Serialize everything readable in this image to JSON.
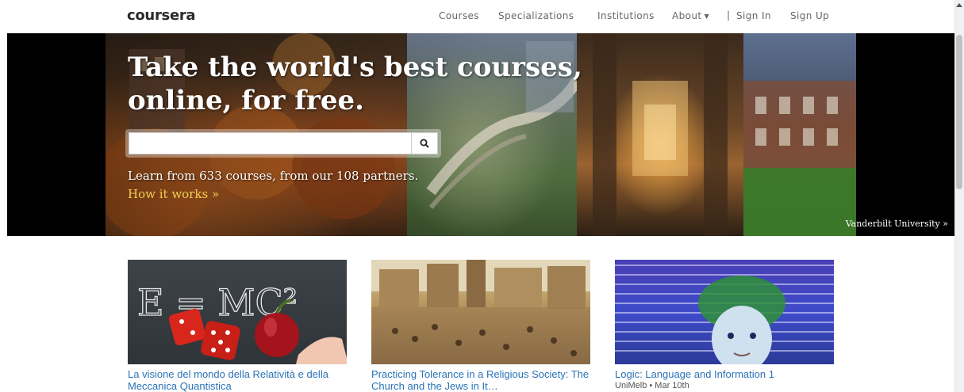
{
  "header": {
    "logo": "coursera",
    "nav": {
      "courses": "Courses",
      "specializations": "Specializations",
      "institutions": "Institutions",
      "about": "About",
      "separator": "|",
      "sign_in": "Sign In",
      "sign_up": "Sign Up"
    }
  },
  "hero": {
    "title_line1": "Take the world's best courses,",
    "title_line2": "online, for free.",
    "search": {
      "value": "",
      "icon": "search-icon"
    },
    "subtitle": "Learn from 633 courses, from our 108 partners.",
    "how_link": "How it works »",
    "photo_credit": "Vanderbilt University »"
  },
  "courses": [
    {
      "title": "La visione del mondo della Relatività e della Meccanica Quantistica",
      "meta": ""
    },
    {
      "title": "Practicing Tolerance in a Religious Society: The Church and the Jews in It…",
      "meta": ""
    },
    {
      "title": "Logic: Language and Information 1",
      "meta": "UniMelb • Mar 10th"
    }
  ],
  "course_images": {
    "card1_formula": "E = MC²"
  },
  "colors": {
    "link": "#2a73b5",
    "hero_link": "#f0d050",
    "nav_text": "#666666"
  }
}
